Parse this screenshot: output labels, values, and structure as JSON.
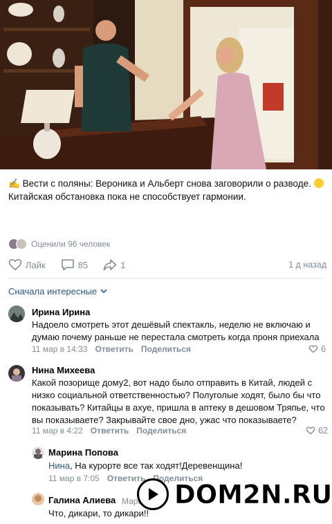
{
  "post": {
    "text_line1": " Вести с поляны: Вероника и Альберт снова заговорили о разводе. ",
    "text_line2": "Китайская обстановка пока не способствует гармонии.",
    "views_text": "Оценили 96 человек",
    "like_label": "Лайк",
    "comments_count": "85",
    "shares_count": "1",
    "date": "1 д назад"
  },
  "comments_section": {
    "sort_label": "Сначала интересные"
  },
  "comments": [
    {
      "author": "Ирина Ирина",
      "text": "Надоело смотреть этот дешёвый спектакль, неделю не включаю и думаю почему раньше не перестала смотреть когда проня приехала",
      "date": "11 мар в 14:33",
      "reply_label": "Ответить",
      "share_label": "Поделиться",
      "likes": "6"
    },
    {
      "author": "Нина Михеева",
      "text": "Какой позорище дому2, вот надо было отправить в Китай, людей с низко социальной ответственностью? Полуголые ходят, было бы что показывать? Китайцы в ахуе, пришла в аптеку в дешовом Тряпье, что вы показываете? Закрывайте свое дно, ужас что показываете?",
      "date": "11 мар в 4:22",
      "reply_label": "Ответить",
      "share_label": "Поделиться",
      "likes": "62"
    }
  ],
  "replies": [
    {
      "author": "Марина Попова",
      "mention": "Нина",
      "text": ", На курорте все так ходят!Деревенщина!",
      "date": "11 мар в 7:05",
      "reply_label": "Ответить",
      "share_label": "Поделиться"
    },
    {
      "author": "Галина Алиева",
      "reply_to": "Марин",
      "text": "Что, дикари, то дикари!!"
    }
  ],
  "watermark": {
    "text": "DOM2N.RU"
  },
  "colors": {
    "link": "#2a5885",
    "secondary": "#818c99",
    "divider": "#e7e8ec"
  }
}
